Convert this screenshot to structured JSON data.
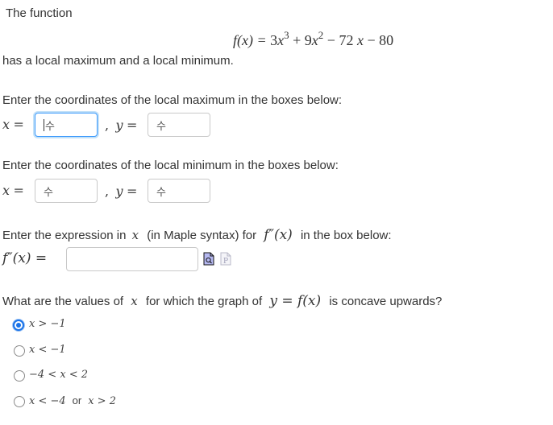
{
  "intro": {
    "line1": "The function",
    "line2": "has a local maximum and a local minimum."
  },
  "formula": {
    "lhs": "f(x) =",
    "term1_coef": "3",
    "term1_var": "x",
    "term1_exp": "3",
    "op1": "+",
    "term2_coef": "9",
    "term2_var": "x",
    "term2_exp": "2",
    "op2": "−",
    "term3": "72",
    "term3_var": "x",
    "op3": "−",
    "const": "80"
  },
  "local_max": {
    "prompt": "Enter the coordinates of the local maximum in the boxes below:",
    "x_label": "x",
    "y_label": "y",
    "eq": "=",
    "comma": ",",
    "x_value": "",
    "y_value": "",
    "math_icon": "수"
  },
  "local_min": {
    "prompt": "Enter the coordinates of the local minimum in the boxes below:",
    "x_label": "x",
    "y_label": "y",
    "eq": "=",
    "comma": ",",
    "x_value": "",
    "y_value": "",
    "math_icon": "수"
  },
  "second_derivative": {
    "prompt_pre": "Enter the expression in",
    "prompt_var": "x",
    "prompt_mid": "(in Maple syntax) for",
    "prompt_fn": "f″(x)",
    "prompt_post": "in the box below:",
    "label": "f″(x) =",
    "value": "",
    "icons": [
      "preview-icon",
      "maple-p-icon"
    ]
  },
  "concavity": {
    "prompt_pre": "What are the values of",
    "prompt_var": "x",
    "prompt_mid": "for which the graph of",
    "prompt_eq": "y = f(x)",
    "prompt_post": "is concave upwards?",
    "options": [
      {
        "label": "x > −1",
        "selected": true
      },
      {
        "label": "x < −1",
        "selected": false
      },
      {
        "label": "−4 < x < 2",
        "selected": false
      },
      {
        "label_a": "x < −4",
        "or": "or",
        "label_b": "x > 2",
        "selected": false
      }
    ]
  },
  "colors": {
    "focus": "#3b99fc",
    "radio_selected": "#1a73e8",
    "text": "#333333"
  }
}
